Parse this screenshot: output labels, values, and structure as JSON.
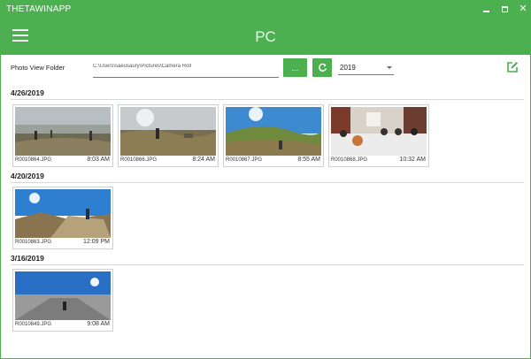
{
  "window": {
    "title": "THETAWINAPP"
  },
  "header": {
    "title": "PC"
  },
  "toolbar": {
    "folder_label": "Photo View Folder",
    "folder_path": "C:\\Users\\saeusaury\\Pictures\\Camera Roll",
    "browse_label": "...",
    "year": "2019"
  },
  "colors": {
    "accent": "#4caf50"
  },
  "groups": [
    {
      "date": "4/26/2019",
      "photos": [
        {
          "file": "R0010864.JPG",
          "time": "8:03 AM"
        },
        {
          "file": "R0010866.JPG",
          "time": "8:24 AM"
        },
        {
          "file": "R0010867.JPG",
          "time": "8:55 AM"
        },
        {
          "file": "R0010868.JPG",
          "time": "10:32 AM"
        }
      ]
    },
    {
      "date": "4/20/2019",
      "photos": [
        {
          "file": "R0010863.JPG",
          "time": "12:09 PM"
        }
      ]
    },
    {
      "date": "3/16/2019",
      "photos": [
        {
          "file": "R0010849.JPG",
          "time": "9:08 AM"
        }
      ]
    }
  ]
}
